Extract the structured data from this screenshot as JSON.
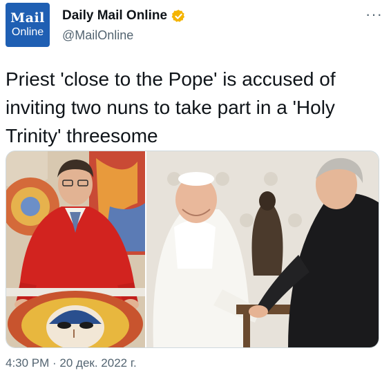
{
  "account": {
    "display_name": "Daily Mail Online",
    "handle": "@MailOnline",
    "avatar_line1": "Mail",
    "avatar_line2": "Online",
    "verified_icon": "verified-badge-icon",
    "verified_color": "#f4b400"
  },
  "menu": {
    "more_label": "···"
  },
  "tweet": {
    "text": "Priest 'close to the Pope' is accused of inviting two nuns to take part in a 'Holy Trinity' threesome",
    "timestamp": "4:30 PM · 20 дек. 2022 г."
  },
  "media": {
    "images": [
      {
        "name": "priest-with-mosaic-photo"
      },
      {
        "name": "pope-handshake-photo"
      }
    ]
  },
  "colors": {
    "text_primary": "#0f1419",
    "text_secondary": "#536471",
    "brand": "#1f5fb3",
    "border": "#cfd9de"
  }
}
